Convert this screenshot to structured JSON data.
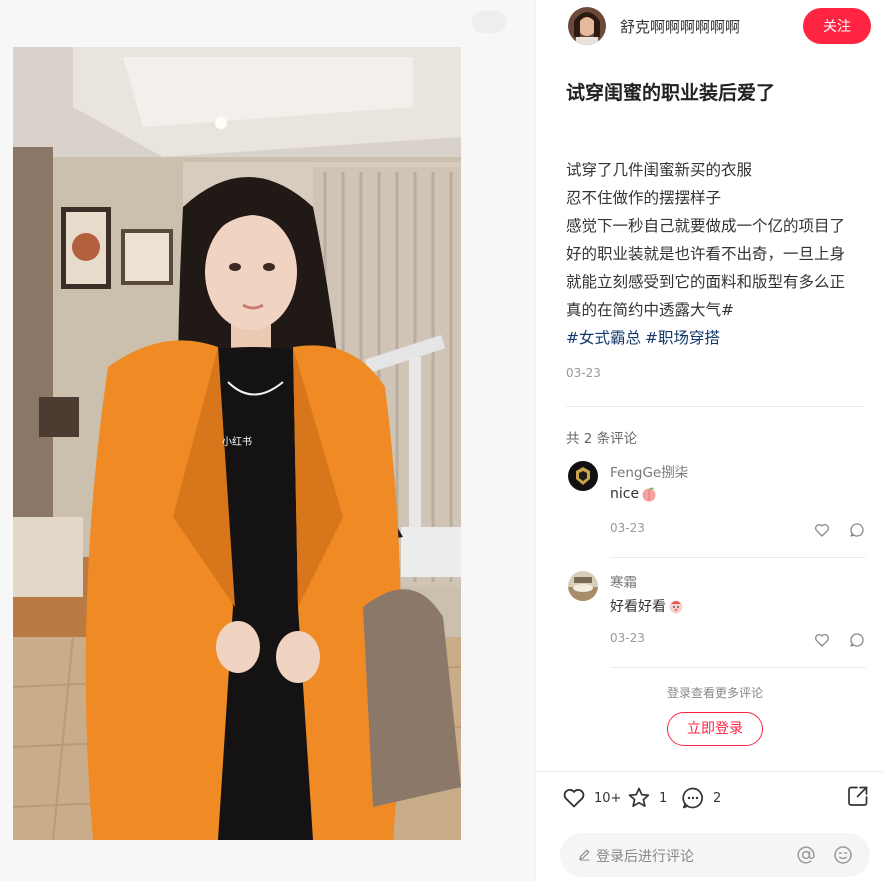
{
  "media": {
    "watermark": "小红书"
  },
  "author": {
    "name": "舒克啊啊啊啊啊啊",
    "follow_label": "关注"
  },
  "note": {
    "title": "试穿闺蜜的职业装后爱了",
    "lines": [
      "试穿了几件闺蜜新买的衣服",
      "忍不住做作的摆摆样子",
      "感觉下一秒自己就要做成一个亿的项目了",
      "好的职业装就是也许看不出奇，一旦上身",
      "就能立刻感受到它的面料和版型有多么正",
      "真的在简约中透露大气#"
    ],
    "tags": [
      "#女式霸总",
      "#职场穿搭"
    ],
    "date": "03-23"
  },
  "comments": {
    "count_label": "共 2 条评论",
    "items": [
      {
        "author": "FengGe捌柒",
        "text": "nice",
        "date": "03-23"
      },
      {
        "author": "寒霜",
        "text": "好看好看",
        "date": "03-23"
      }
    ],
    "more_hint": "登录查看更多评论",
    "login_label": "立即登录"
  },
  "engagement": {
    "likes": "10+",
    "collects": "1",
    "comments": "2"
  },
  "comment_input": {
    "placeholder": "登录后进行评论"
  },
  "colors": {
    "brand": "#ff2442",
    "tag": "#13386c"
  },
  "icons": [
    "heart-icon",
    "star-icon",
    "comment-icon",
    "share-icon",
    "pencil-icon",
    "at-icon",
    "emoji-icon"
  ]
}
